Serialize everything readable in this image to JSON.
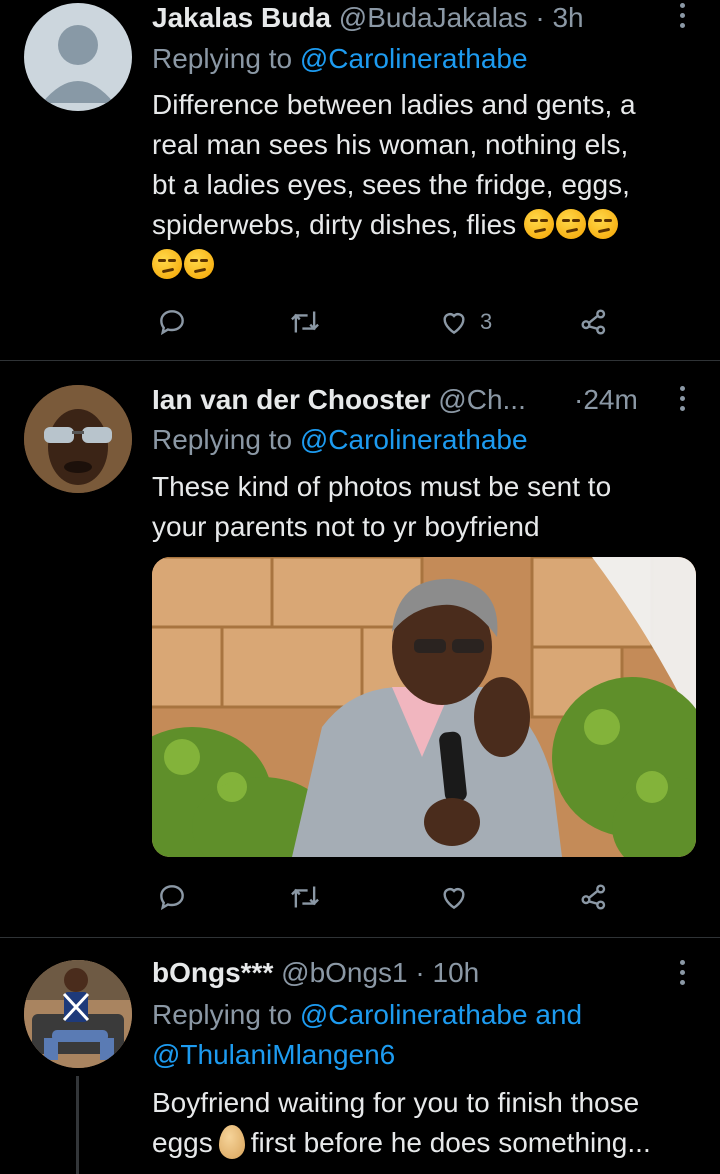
{
  "tweets": [
    {
      "name": "Jakalas Buda",
      "handle": "@BudaJakalas",
      "dot": "·",
      "time": "3h",
      "replying_prefix": "Replying to ",
      "replying_to": "@Carolinerathabe",
      "text_lines": [
        "Difference between ladies and gents, a",
        "real man sees his woman, nothing els,",
        "bt a ladies eyes, sees the fridge, eggs,",
        "spiderwebs, dirty dishes, flies"
      ],
      "emoji_icon": "smirking-face-emoji",
      "like_count": "3"
    },
    {
      "name": "Ian van der Chooster",
      "handle": "@Ch...",
      "dot": "·",
      "time": "24m",
      "replying_prefix": "Replying to ",
      "replying_to": "@Carolinerathabe",
      "text_lines": [
        "These kind of photos must be sent to",
        "your parents not to yr boyfriend"
      ]
    },
    {
      "name": "bOngs***",
      "handle": "@bOngs1",
      "dot": "·",
      "time": "10h",
      "replying_prefix": "Replying to ",
      "replying_to": "@Carolinerathabe",
      "replying_and": " and",
      "replying_to_2": "@ThulaniMlangen6",
      "text_line_1": "Boyfriend waiting for you to finish those",
      "text_line_2a": "eggs",
      "text_line_2b": "first before he does something..."
    }
  ],
  "icons": {
    "reply": "reply-icon",
    "retweet": "retweet-icon",
    "like": "heart-icon",
    "share": "share-icon",
    "more": "more-options-icon"
  },
  "colors": {
    "background": "#000000",
    "text": "#e7e9ea",
    "secondary": "#8b98a5",
    "accent": "#1d9bf0",
    "divider": "#2f3336"
  }
}
